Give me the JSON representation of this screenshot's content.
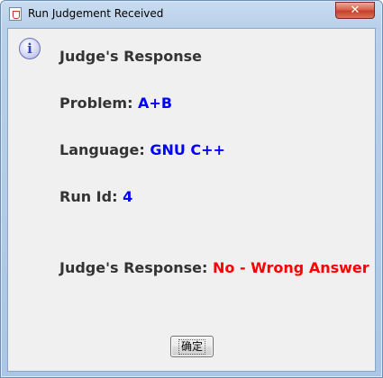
{
  "window": {
    "title": "Run Judgement Received",
    "close_label": "✕"
  },
  "dialog": {
    "icon": "info-icon",
    "heading": "Judge's Response",
    "problem_label": "Problem:",
    "problem_value": "A+B",
    "language_label": "Language:",
    "language_value": "GNU C++",
    "runid_label": "Run Id:",
    "runid_value": "4",
    "response_label": "Judge's Response:",
    "response_value": "No - Wrong Answer"
  },
  "buttons": {
    "ok_label": "确定"
  },
  "colors": {
    "value_blue": "#0000ff",
    "value_red": "#ff0000",
    "label_text": "#333333"
  }
}
